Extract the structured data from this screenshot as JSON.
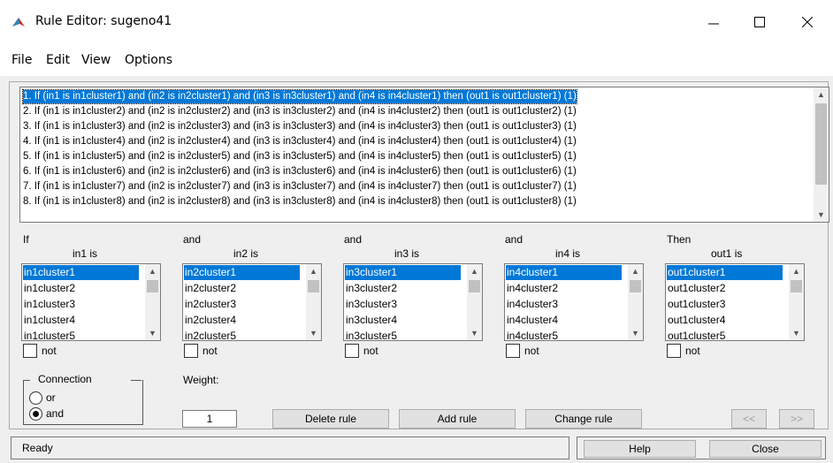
{
  "window": {
    "title": "Rule Editor: sugeno41"
  },
  "menu": [
    "File",
    "Edit",
    "View",
    "Options"
  ],
  "rules": [
    "1. If (in1 is in1cluster1) and (in2 is in2cluster1) and (in3 is in3cluster1) and (in4 is in4cluster1) then (out1 is out1cluster1) (1)",
    "2. If (in1 is in1cluster2) and (in2 is in2cluster2) and (in3 is in3cluster2) and (in4 is in4cluster2) then (out1 is out1cluster2) (1)",
    "3. If (in1 is in1cluster3) and (in2 is in2cluster3) and (in3 is in3cluster3) and (in4 is in4cluster3) then (out1 is out1cluster3) (1)",
    "4. If (in1 is in1cluster4) and (in2 is in2cluster4) and (in3 is in3cluster4) and (in4 is in4cluster4) then (out1 is out1cluster4) (1)",
    "5. If (in1 is in1cluster5) and (in2 is in2cluster5) and (in3 is in3cluster5) and (in4 is in4cluster5) then (out1 is out1cluster5) (1)",
    "6. If (in1 is in1cluster6) and (in2 is in2cluster6) and (in3 is in3cluster6) and (in4 is in4cluster6) then (out1 is out1cluster6) (1)",
    "7. If (in1 is in1cluster7) and (in2 is in2cluster7) and (in3 is in3cluster7) and (in4 is in4cluster7) then (out1 is out1cluster7) (1)",
    "8. If (in1 is in1cluster8) and (in2 is in2cluster8) and (in3 is in3cluster8) and (in4 is in4cluster8) then (out1 is out1cluster8) (1)"
  ],
  "columns": [
    {
      "connector": "If",
      "var_label": "in1 is",
      "items": [
        "in1cluster1",
        "in1cluster2",
        "in1cluster3",
        "in1cluster4",
        "in1cluster5"
      ],
      "not_label": "not"
    },
    {
      "connector": "and",
      "var_label": "in2 is",
      "items": [
        "in2cluster1",
        "in2cluster2",
        "in2cluster3",
        "in2cluster4",
        "in2cluster5"
      ],
      "not_label": "not"
    },
    {
      "connector": "and",
      "var_label": "in3 is",
      "items": [
        "in3cluster1",
        "in3cluster2",
        "in3cluster3",
        "in3cluster4",
        "in3cluster5"
      ],
      "not_label": "not"
    },
    {
      "connector": "and",
      "var_label": "in4 is",
      "items": [
        "in4cluster1",
        "in4cluster2",
        "in4cluster3",
        "in4cluster4",
        "in4cluster5"
      ],
      "not_label": "not"
    },
    {
      "connector": "Then",
      "var_label": "out1 is",
      "items": [
        "out1cluster1",
        "out1cluster2",
        "out1cluster3",
        "out1cluster4",
        "out1cluster5"
      ],
      "not_label": "not"
    }
  ],
  "connection": {
    "label": "Connection",
    "or": "or",
    "and": "and",
    "selected": "and"
  },
  "weight": {
    "label": "Weight:",
    "value": "1"
  },
  "buttons": {
    "delete": "Delete rule",
    "add": "Add rule",
    "change": "Change rule",
    "prev": "<<",
    "next": ">>",
    "help": "Help",
    "close": "Close"
  },
  "status": "Ready"
}
